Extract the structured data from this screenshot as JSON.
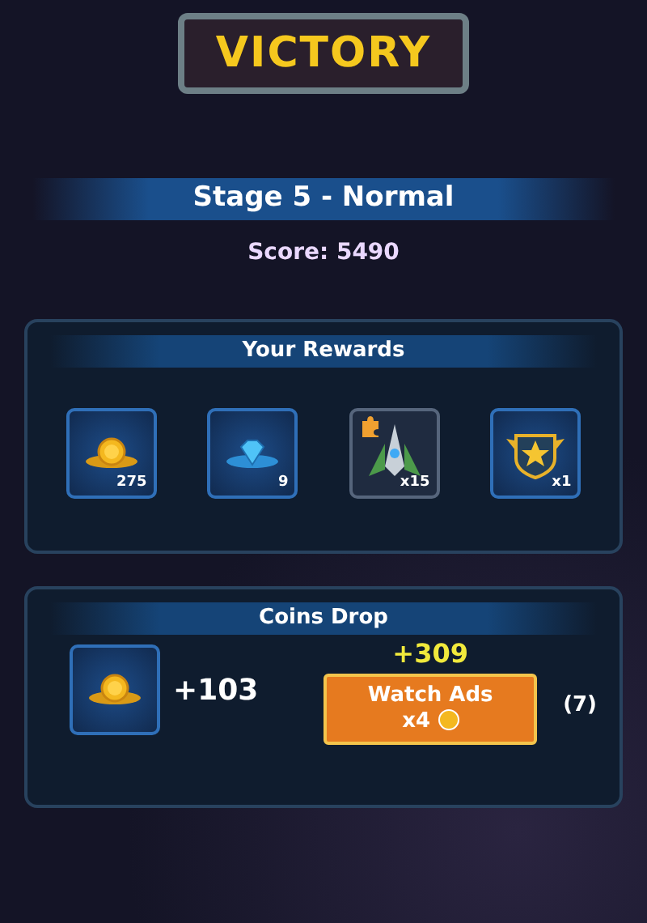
{
  "title": "VICTORY",
  "stage": "Stage 5 - Normal",
  "score": "Score: 5490",
  "rewards": {
    "title": "Your Rewards",
    "items": [
      {
        "kind": "coins",
        "count": "275"
      },
      {
        "kind": "gems",
        "count": "9"
      },
      {
        "kind": "ship",
        "count": "x15"
      },
      {
        "kind": "badge",
        "count": "x1"
      }
    ]
  },
  "coins_drop": {
    "title": "Coins Drop",
    "amount": "+103",
    "bonus": "+309",
    "button": {
      "label": "Watch Ads",
      "multiplier": "x4"
    },
    "remaining": "(7)"
  }
}
